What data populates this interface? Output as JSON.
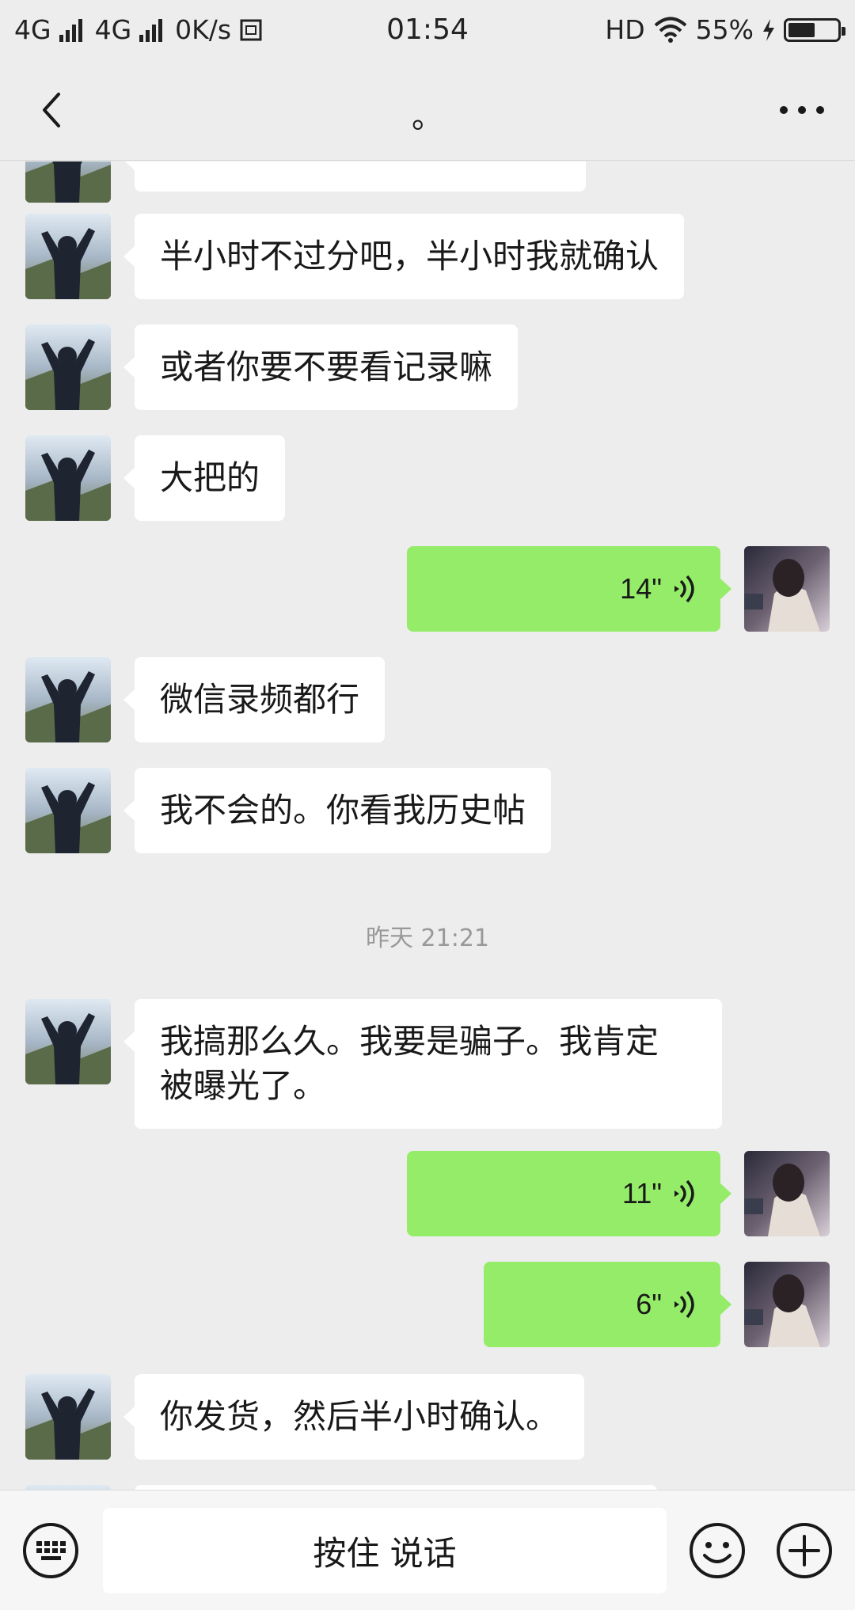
{
  "status_bar": {
    "network1": "4G",
    "network2": "4G",
    "speed": "0K/s",
    "time": "01:54",
    "hd": "HD",
    "battery": "55%",
    "battery_level": 0.55
  },
  "nav": {
    "title": "。",
    "back_icon": "chevron-left-icon",
    "more_icon": "more-dots-icon"
  },
  "messages": [
    {
      "kind": "text",
      "from": "other",
      "text": "半小时不过分吧，半小时我就确认"
    },
    {
      "kind": "text",
      "from": "other",
      "text": "或者你要不要看记录嘛"
    },
    {
      "kind": "text",
      "from": "other",
      "text": "大把的"
    },
    {
      "kind": "voice",
      "from": "me",
      "duration": "14\""
    },
    {
      "kind": "text",
      "from": "other",
      "text": "微信录频都行"
    },
    {
      "kind": "text",
      "from": "other",
      "text": "我不会的。你看我历史帖"
    },
    {
      "kind": "time",
      "text": "昨天 21:21"
    },
    {
      "kind": "text",
      "from": "other",
      "line1": "我搞那么久。我要是骗子。我肯定",
      "line2": "被曝光了。"
    },
    {
      "kind": "voice",
      "from": "me",
      "duration": "11\""
    },
    {
      "kind": "voice",
      "from": "me",
      "duration": "6\""
    },
    {
      "kind": "text",
      "from": "other",
      "text": "你发货，然后半小时确认。"
    }
  ],
  "bottom": {
    "hold_to_talk": "按住 说话",
    "keyboard_icon": "keyboard-icon",
    "emoji_icon": "emoji-icon",
    "plus_icon": "plus-icon"
  },
  "colors": {
    "background": "#ededed",
    "out_bubble": "#95ec69",
    "in_bubble": "#ffffff"
  }
}
